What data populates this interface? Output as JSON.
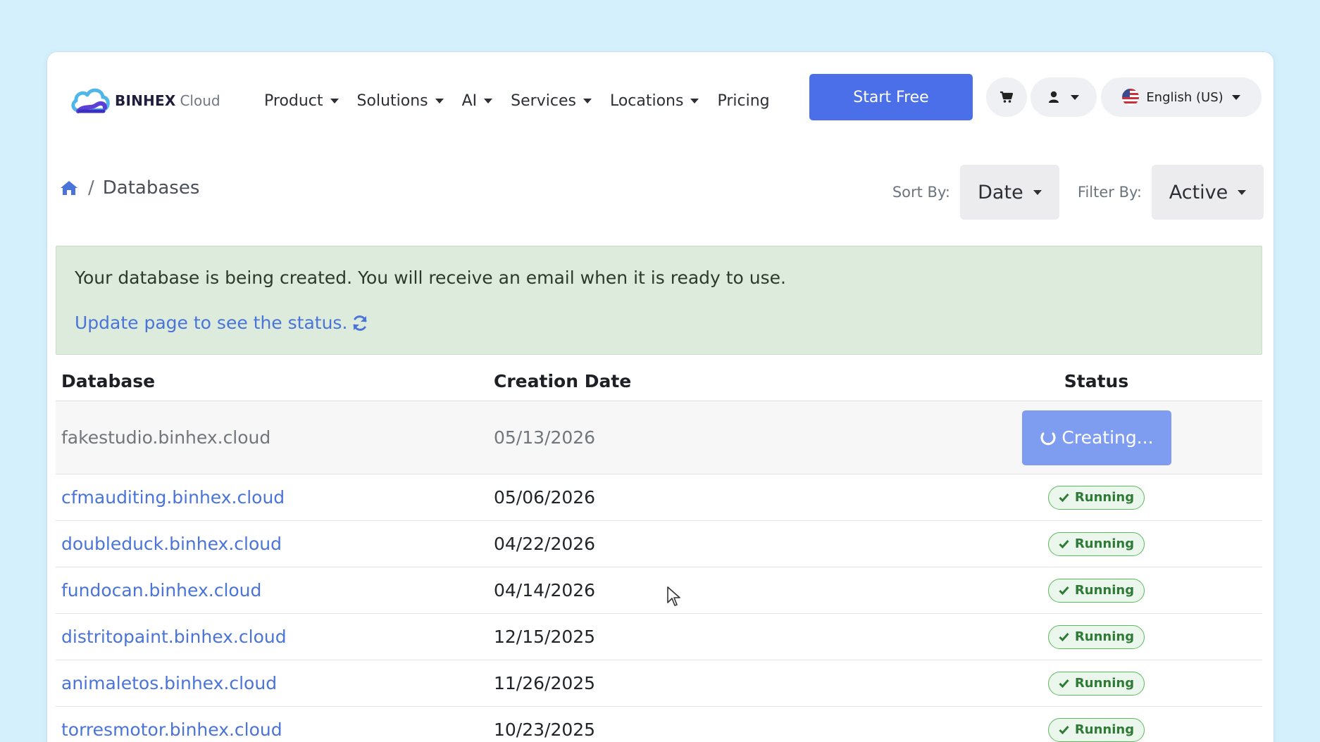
{
  "brand": {
    "name": "BINHEX",
    "sub": "Cloud"
  },
  "nav": {
    "items": [
      {
        "label": "Product",
        "dropdown": true
      },
      {
        "label": "Solutions",
        "dropdown": true
      },
      {
        "label": "AI",
        "dropdown": true
      },
      {
        "label": "Services",
        "dropdown": true
      },
      {
        "label": "Locations",
        "dropdown": true
      },
      {
        "label": "Pricing",
        "dropdown": false
      }
    ],
    "start_free": "Start Free",
    "cart_icon": "cart-icon",
    "user_icon": "user-icon",
    "language": "English (US)"
  },
  "breadcrumb": {
    "home_icon": "home-icon",
    "separator": "/",
    "current": "Databases"
  },
  "sort": {
    "label": "Sort By:",
    "value": "Date"
  },
  "filter": {
    "label": "Filter By:",
    "value": "Active"
  },
  "alert": {
    "message": "Your database is being created. You will receive an email when it is ready to use.",
    "link": "Update page to see the status."
  },
  "table": {
    "headers": {
      "database": "Database",
      "creation_date": "Creation Date",
      "status": "Status"
    },
    "rows": [
      {
        "database": "fakestudio.binhex.cloud",
        "date": "05/13/2026",
        "status": "Creating..."
      },
      {
        "database": "cfmauditing.binhex.cloud",
        "date": "05/06/2026",
        "status": "Running"
      },
      {
        "database": "doubleduck.binhex.cloud",
        "date": "04/22/2026",
        "status": "Running"
      },
      {
        "database": "fundocan.binhex.cloud",
        "date": "04/14/2026",
        "status": "Running"
      },
      {
        "database": "distritopaint.binhex.cloud",
        "date": "12/15/2025",
        "status": "Running"
      },
      {
        "database": "animaletos.binhex.cloud",
        "date": "11/26/2025",
        "status": "Running"
      },
      {
        "database": "torresmotor.binhex.cloud",
        "date": "10/23/2025",
        "status": "Running"
      }
    ]
  },
  "colors": {
    "background": "#d4f0fc",
    "primary": "#4a6fe8",
    "link": "#4a74d9",
    "alert_bg": "#dcebdb",
    "running": "#2f7a36",
    "creating": "#7e9cf0"
  }
}
